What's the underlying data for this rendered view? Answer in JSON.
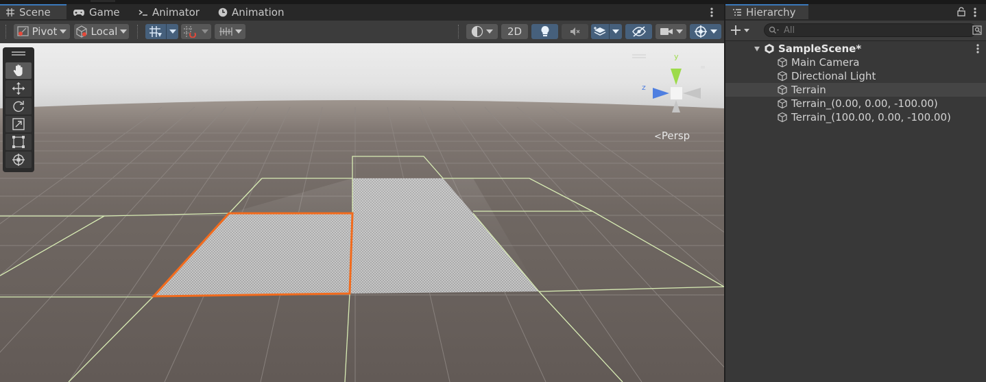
{
  "scene_tabs": [
    {
      "label": "Scene",
      "icon": "grid-icon",
      "active": true
    },
    {
      "label": "Game",
      "icon": "gamepad-icon",
      "active": false
    },
    {
      "label": "Animator",
      "icon": "animator-icon",
      "active": false
    },
    {
      "label": "Animation",
      "icon": "clock-icon",
      "active": false
    }
  ],
  "toolbar": {
    "pivot_label": "Pivot",
    "local_label": "Local",
    "mode_2d_label": "2D"
  },
  "tools": [
    "hand-tool-icon",
    "move-tool-icon",
    "rotate-tool-icon",
    "scale-tool-icon",
    "rect-tool-icon",
    "transform-tool-icon"
  ],
  "gizmo": {
    "persp_label": "Persp",
    "y_axis": "y",
    "z_axis": "z"
  },
  "hierarchy": {
    "title": "Hierarchy",
    "search_placeholder": "All",
    "scene_name": "SampleScene*",
    "items": [
      {
        "label": "Main Camera",
        "selected": false
      },
      {
        "label": "Directional Light",
        "selected": false
      },
      {
        "label": "Terrain",
        "selected": true
      },
      {
        "label": "Terrain_(0.00, 0.00, -100.00)",
        "selected": false
      },
      {
        "label": "Terrain_(100.00, 0.00, -100.00)",
        "selected": false
      }
    ]
  },
  "colors": {
    "selection_outline": "#f26b1d",
    "grid_outline": "#d8ecb4",
    "accent_blue": "#46607c"
  }
}
